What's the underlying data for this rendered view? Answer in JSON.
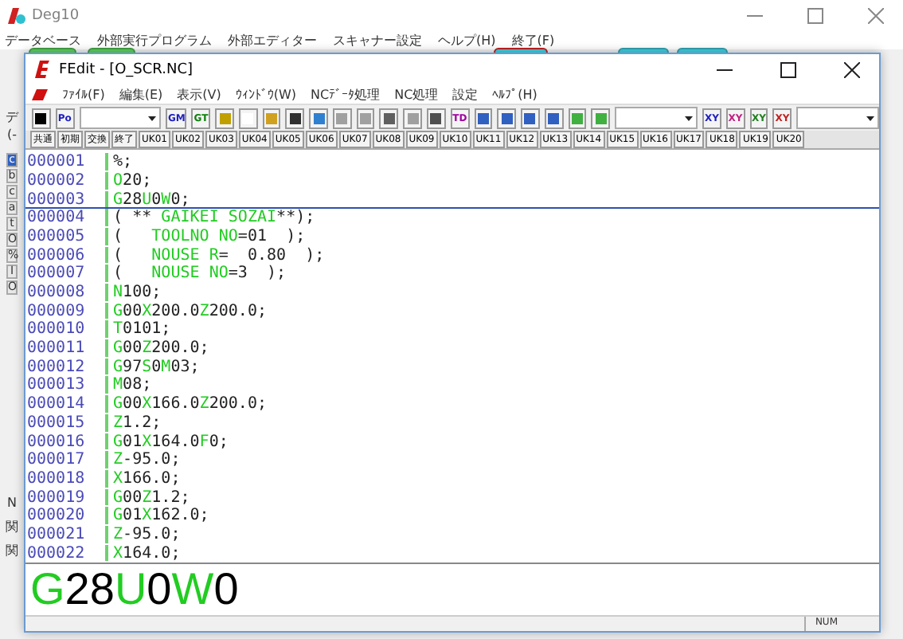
{
  "main_window": {
    "title": "Deg10",
    "menu": [
      "データベース",
      "外部実行プログラム",
      "外部エディター",
      "スキャナー設定",
      "ヘルプ(H)",
      "終了(F)"
    ]
  },
  "left_strip": {
    "top_label": "デ",
    "second_label": "(-",
    "tabs": [
      {
        "label": "c",
        "selected": true
      },
      {
        "label": "b",
        "selected": false
      },
      {
        "label": "c",
        "selected": false
      },
      {
        "label": "a",
        "selected": false
      },
      {
        "label": "t",
        "selected": false
      },
      {
        "label": "O",
        "selected": false
      },
      {
        "label": "%",
        "selected": false
      },
      {
        "label": "I",
        "selected": false
      },
      {
        "label": "O",
        "selected": false
      }
    ],
    "bottom_labels": [
      "N",
      "関",
      "関"
    ]
  },
  "editor_window": {
    "title": "FEdit - [O_SCR.NC]",
    "menu": [
      "ﾌｧｲﾙ(F)",
      "編集(E)",
      "表示(V)",
      "ｳｨﾝﾄﾞｳ(W)",
      "NCﾃﾞｰﾀ処理",
      "NC処理",
      "設定",
      "ﾍﾙﾌﾟ(H)"
    ],
    "toolbar": [
      {
        "kind": "icon",
        "color": "#000000"
      },
      {
        "kind": "text",
        "label": "Po",
        "color": "#2020c0"
      },
      {
        "kind": "combo"
      },
      {
        "kind": "text",
        "label": "GM",
        "color": "#2020c0"
      },
      {
        "kind": "text",
        "label": "GT",
        "color": "#108010"
      },
      {
        "kind": "icon",
        "color": "#c0a000"
      },
      {
        "kind": "icon",
        "color": "#ffffff"
      },
      {
        "kind": "icon",
        "color": "#d0a020"
      },
      {
        "kind": "icon",
        "color": "#303030"
      },
      {
        "kind": "icon",
        "color": "#3080d0"
      },
      {
        "kind": "icon",
        "color": "#a0a0a0"
      },
      {
        "kind": "icon",
        "color": "#a0a0a0"
      },
      {
        "kind": "icon",
        "color": "#606060"
      },
      {
        "kind": "icon",
        "color": "#a0a0a0"
      },
      {
        "kind": "icon",
        "color": "#505050"
      },
      {
        "kind": "text",
        "label": "TD",
        "color": "#a000a0"
      },
      {
        "kind": "icon",
        "color": "#3060c0"
      },
      {
        "kind": "icon",
        "color": "#3060c0"
      },
      {
        "kind": "icon",
        "color": "#3060c0"
      },
      {
        "kind": "icon",
        "color": "#3060c0"
      },
      {
        "kind": "icon",
        "color": "#40b040"
      },
      {
        "kind": "icon",
        "color": "#40b040"
      },
      {
        "kind": "combo"
      },
      {
        "kind": "text",
        "label": "XY",
        "color": "#2020c0"
      },
      {
        "kind": "text",
        "label": "XY",
        "color": "#c02080"
      },
      {
        "kind": "text",
        "label": "XY",
        "color": "#208020"
      },
      {
        "kind": "text",
        "label": "XY",
        "color": "#c02020"
      },
      {
        "kind": "combo"
      }
    ],
    "user_keys": [
      "共通",
      "初期",
      "交換",
      "終了",
      "UK01",
      "UK02",
      "UK03",
      "UK04",
      "UK05",
      "UK06",
      "UK07",
      "UK08",
      "UK09",
      "UK10",
      "UK11",
      "UK12",
      "UK13",
      "UK14",
      "UK15",
      "UK16",
      "UK17",
      "UK18",
      "UK19",
      "UK20"
    ],
    "lines": [
      {
        "number": "000001",
        "code": "%;",
        "current": false
      },
      {
        "number": "000002",
        "code": "O20;",
        "current": false
      },
      {
        "number": "000003",
        "code": "G28U0W0;",
        "current": true
      },
      {
        "number": "000004",
        "code": "( ** GAIKEI SOZAI**);",
        "current": false
      },
      {
        "number": "000005",
        "code": "(   TOOLNO NO=01  );",
        "current": false
      },
      {
        "number": "000006",
        "code": "(   NOUSE R=  0.80  );",
        "current": false
      },
      {
        "number": "000007",
        "code": "(   NOUSE NO=3  );",
        "current": false
      },
      {
        "number": "000008",
        "code": "N100;",
        "current": false
      },
      {
        "number": "000009",
        "code": "G00X200.0Z200.0;",
        "current": false
      },
      {
        "number": "000010",
        "code": "T0101;",
        "current": false
      },
      {
        "number": "000011",
        "code": "G00Z200.0;",
        "current": false
      },
      {
        "number": "000012",
        "code": "G97S0M03;",
        "current": false
      },
      {
        "number": "000013",
        "code": "M08;",
        "current": false
      },
      {
        "number": "000014",
        "code": "G00X166.0Z200.0;",
        "current": false
      },
      {
        "number": "000015",
        "code": "Z1.2;",
        "current": false
      },
      {
        "number": "000016",
        "code": "G01X164.0F0;",
        "current": false
      },
      {
        "number": "000017",
        "code": "Z-95.0;",
        "current": false
      },
      {
        "number": "000018",
        "code": "X166.0;",
        "current": false
      },
      {
        "number": "000019",
        "code": "G00Z1.2;",
        "current": false
      },
      {
        "number": "000020",
        "code": "G01X162.0;",
        "current": false
      },
      {
        "number": "000021",
        "code": "Z-95.0;",
        "current": false
      },
      {
        "number": "000022",
        "code": "X164.0;",
        "current": false
      }
    ],
    "preview": "G28U0W0",
    "status_bar": [
      "NUM"
    ]
  }
}
